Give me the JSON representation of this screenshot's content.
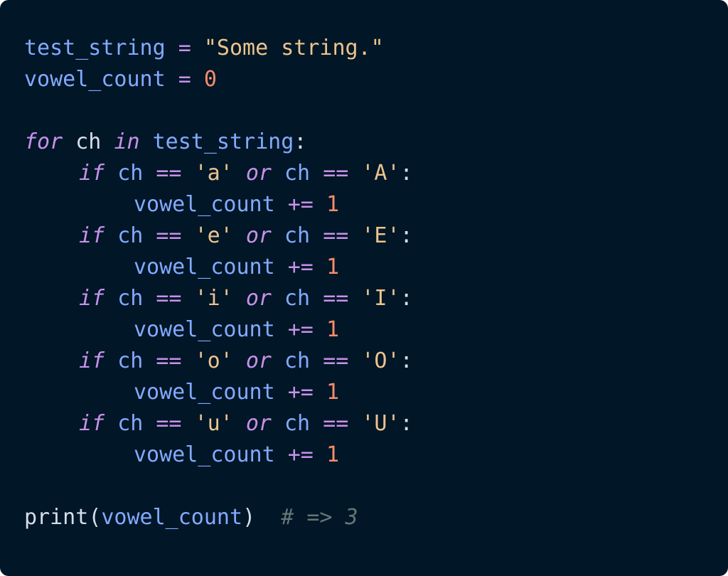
{
  "colors": {
    "background": "#011627",
    "variable": "#82aaff",
    "operator": "#c792ea",
    "string": "#ecc48d",
    "number": "#f78c6c",
    "keyword": "#c792ea",
    "comment": "#637777"
  },
  "code": {
    "line1": {
      "var": "test_string",
      "assign": "=",
      "value": "\"Some string.\""
    },
    "line2": {
      "var": "vowel_count",
      "assign": "=",
      "value": "0"
    },
    "loop": {
      "kw_for": "for",
      "var": "ch",
      "kw_in": "in",
      "iter": "test_string",
      "colon": ":"
    },
    "checks": [
      {
        "kw_if": "if",
        "var": "ch",
        "eq": "==",
        "lower": "'a'",
        "kw_or": "or",
        "var2": "ch",
        "eq2": "==",
        "upper": "'A'",
        "colon": ":",
        "target": "vowel_count",
        "aug": "+=",
        "inc": "1"
      },
      {
        "kw_if": "if",
        "var": "ch",
        "eq": "==",
        "lower": "'e'",
        "kw_or": "or",
        "var2": "ch",
        "eq2": "==",
        "upper": "'E'",
        "colon": ":",
        "target": "vowel_count",
        "aug": "+=",
        "inc": "1"
      },
      {
        "kw_if": "if",
        "var": "ch",
        "eq": "==",
        "lower": "'i'",
        "kw_or": "or",
        "var2": "ch",
        "eq2": "==",
        "upper": "'I'",
        "colon": ":",
        "target": "vowel_count",
        "aug": "+=",
        "inc": "1"
      },
      {
        "kw_if": "if",
        "var": "ch",
        "eq": "==",
        "lower": "'o'",
        "kw_or": "or",
        "var2": "ch",
        "eq2": "==",
        "upper": "'O'",
        "colon": ":",
        "target": "vowel_count",
        "aug": "+=",
        "inc": "1"
      },
      {
        "kw_if": "if",
        "var": "ch",
        "eq": "==",
        "lower": "'u'",
        "kw_or": "or",
        "var2": "ch",
        "eq2": "==",
        "upper": "'U'",
        "colon": ":",
        "target": "vowel_count",
        "aug": "+=",
        "inc": "1"
      }
    ],
    "print": {
      "func": "print",
      "open": "(",
      "arg": "vowel_count",
      "close": ")",
      "comment": "# => 3"
    }
  }
}
